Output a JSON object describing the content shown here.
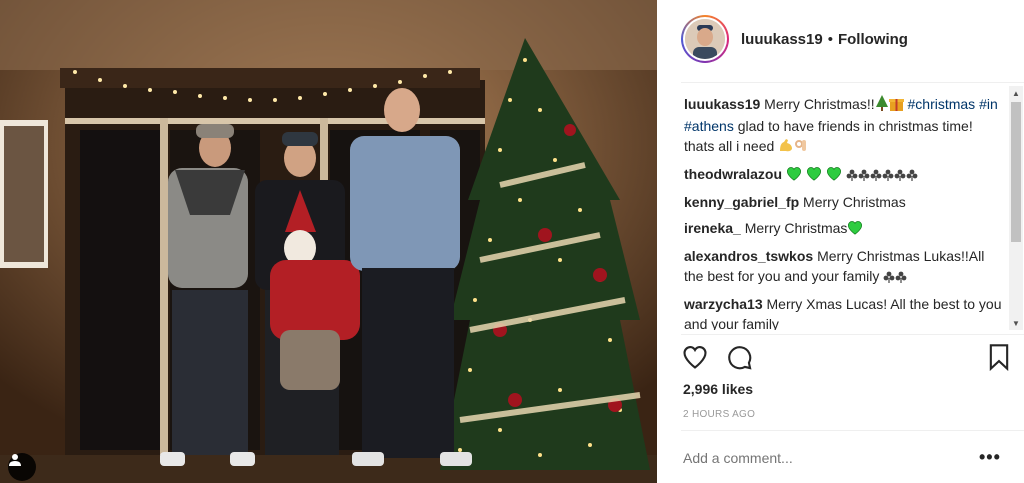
{
  "header": {
    "username": "luuukass19",
    "separator": "•",
    "follow_status": "Following"
  },
  "comments": [
    {
      "user": "luuukass19",
      "segments": [
        {
          "t": "text",
          "v": "Merry Christmas!!"
        },
        {
          "t": "emoji",
          "v": "tree-gift"
        },
        {
          "t": "tag",
          "v": "#christmas"
        },
        {
          "t": "text",
          "v": " "
        },
        {
          "t": "tag",
          "v": "#in"
        },
        {
          "t": "text",
          "v": " "
        },
        {
          "t": "tag",
          "v": "#athens"
        },
        {
          "t": "text",
          "v": " glad to have friends in christmas time! thats all i need "
        },
        {
          "t": "emoji",
          "v": "muscle-ok"
        }
      ]
    },
    {
      "user": "theodwralazou",
      "segments": [
        {
          "t": "emoji",
          "v": "green-hearts-clovers"
        }
      ]
    },
    {
      "user": "kenny_gabriel_fp",
      "segments": [
        {
          "t": "text",
          "v": "Merry Christmas"
        }
      ]
    },
    {
      "user": "ireneka_",
      "segments": [
        {
          "t": "text",
          "v": "Merry Christmas"
        },
        {
          "t": "emoji",
          "v": "green-heart"
        }
      ]
    },
    {
      "user": "alexandros_tswkos",
      "segments": [
        {
          "t": "text",
          "v": "Merry Christmas Lukas!!All the best for you and your family "
        },
        {
          "t": "emoji",
          "v": "clovers"
        }
      ]
    },
    {
      "user": "warzycha13",
      "segments": [
        {
          "t": "text",
          "v": "Merry Xmas Lucas! All the best to you and your family "
        }
      ]
    }
  ],
  "actions": {
    "like_icon": "heart-icon",
    "comment_icon": "comment-icon",
    "save_icon": "bookmark-icon"
  },
  "likes_text": "2,996 likes",
  "timestamp": "2 HOURS AGO",
  "add_comment_placeholder": "Add a comment...",
  "more_label": "•••",
  "colors": {
    "hashtag": "#003569",
    "text": "#262626",
    "muted": "#999999",
    "emoji_heart": "#2ecc40"
  }
}
